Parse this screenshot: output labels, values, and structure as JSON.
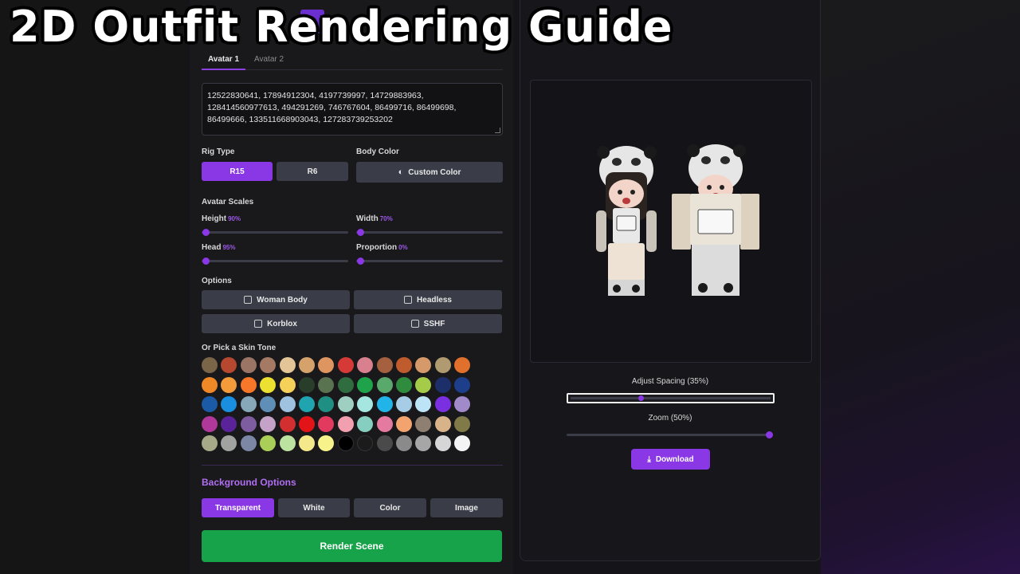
{
  "title": "2D Outfit Rendering Guide",
  "tabs": [
    {
      "label": "Avatar 1",
      "active": true
    },
    {
      "label": "Avatar 2",
      "active": false
    }
  ],
  "asset_ids": "12522830641, 17894912304, 4197739997, 14729883963, 128414560977613, 494291269, 746767604, 86499716, 86499698, 86499666, 133511668903043, 127283739253202",
  "rig": {
    "label": "Rig Type",
    "options": [
      "R15",
      "R6"
    ],
    "selected": "R15"
  },
  "body_color": {
    "label": "Body Color",
    "button": "Custom Color",
    "icon": "palette-icon"
  },
  "scales": {
    "label": "Avatar Scales",
    "height": {
      "label": "Height",
      "value": "90%"
    },
    "width": {
      "label": "Width",
      "value": "70%"
    },
    "head": {
      "label": "Head",
      "value": "95%"
    },
    "proportion": {
      "label": "Proportion",
      "value": "0%"
    }
  },
  "options": {
    "label": "Options",
    "items": [
      "Woman Body",
      "Headless",
      "Korblox",
      "SSHF"
    ]
  },
  "skin_tone": {
    "label": "Or Pick a Skin Tone",
    "colors": [
      "#7a6548",
      "#b5482e",
      "#9a7566",
      "#a57a64",
      "#e3c597",
      "#d6a26b",
      "#de955f",
      "#d63a36",
      "#d9808e",
      "#a5603f",
      "#c05b2e",
      "#d69a6a",
      "#b09a6f",
      "#e0702c",
      "#f08828",
      "#f39a3a",
      "#f6762a",
      "#ece030",
      "#f5d15a",
      "#283e2a",
      "#597250",
      "#2f6c3f",
      "#1fa34a",
      "#5aa96c",
      "#2f8c3e",
      "#a5cc48",
      "#1d2f6a",
      "#1d3e8b",
      "#1b5aa6",
      "#1a8fe0",
      "#86a8b8",
      "#5f8fb6",
      "#9fc2e0",
      "#1fa4b0",
      "#1e8f82",
      "#9fcfc0",
      "#a6e6e0",
      "#20b4e8",
      "#a7cde6",
      "#bde3f7",
      "#7a2fe0",
      "#a08ac9",
      "#b0389a",
      "#5a2399",
      "#7d5c9f",
      "#c5a2c7",
      "#d23030",
      "#e21418",
      "#e23a5e",
      "#f2a0b0",
      "#86cfc0",
      "#e47aa0",
      "#f2a36e",
      "#8e7f70",
      "#d8b38a",
      "#7f7a48",
      "#a6aa86",
      "#a0a3a0",
      "#7c87a6",
      "#aacf58",
      "#bde3a0",
      "#f3e88a",
      "#f7f28a",
      "#000000",
      "#1b1b1b",
      "#4a4a4a",
      "#8a8a8a",
      "#a6a6a6",
      "#d6d6d6",
      "#f4f4f4"
    ],
    "extra_colors": [
      "#5f8f50",
      "#8a6fb2",
      "#2f6e3f",
      "#f2f2f2"
    ]
  },
  "background": {
    "label": "Background Options",
    "options": [
      "Transparent",
      "White",
      "Color",
      "Image"
    ],
    "selected": "Transparent"
  },
  "render_button": "Render Scene",
  "preview": {
    "spacing": {
      "label": "Adjust Spacing (35%)",
      "value": 35
    },
    "zoom": {
      "label": "Zoom (50%)",
      "value": 50
    },
    "download": "Download",
    "download_icon": "download-icon"
  }
}
